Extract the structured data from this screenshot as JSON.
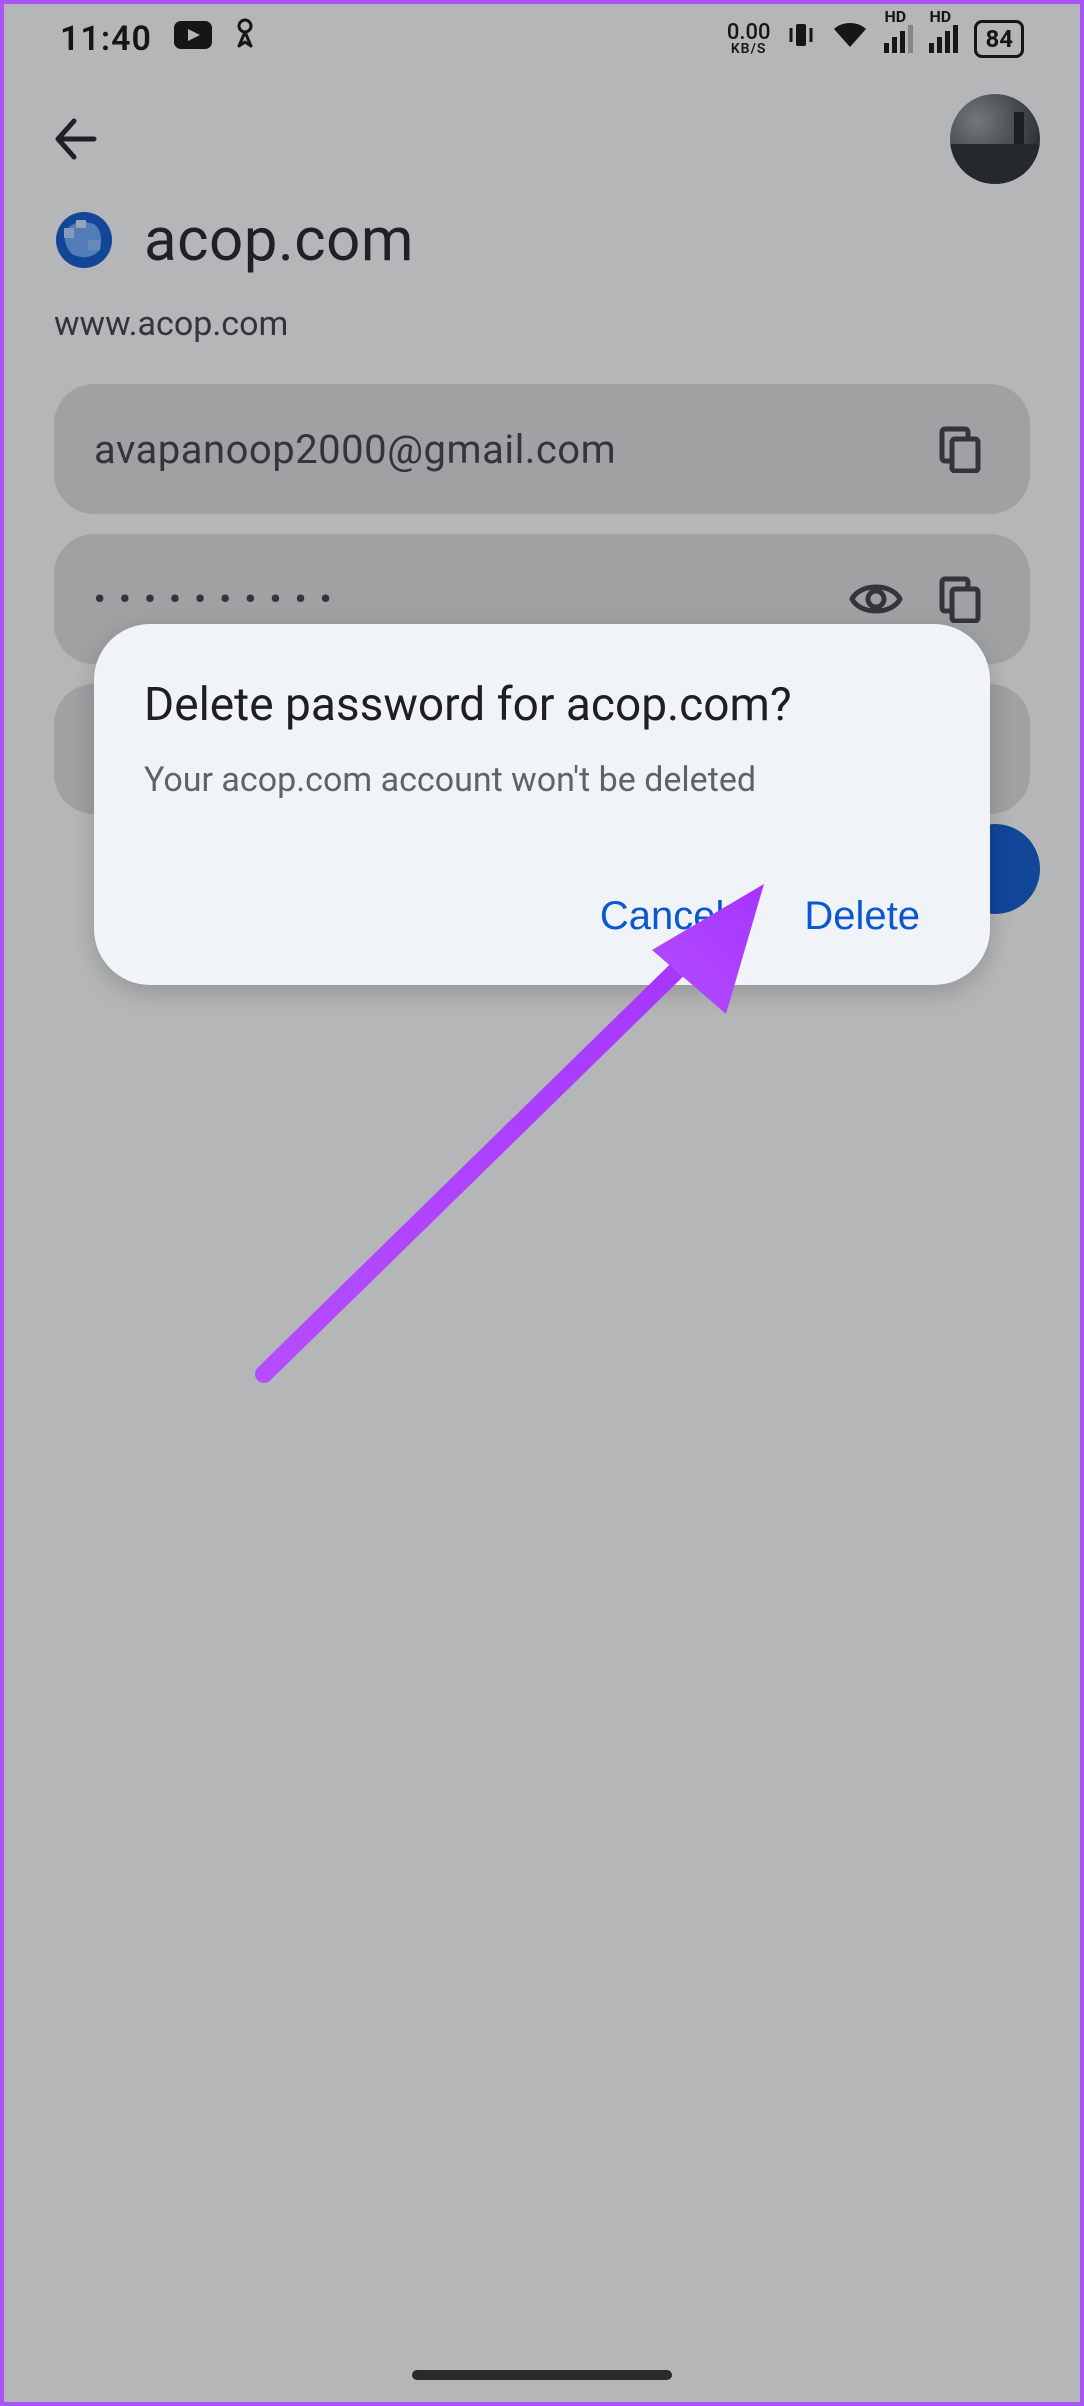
{
  "status_bar": {
    "time": "11:40",
    "data_rate_value": "0.00",
    "data_rate_unit": "KB/S",
    "hd1": "HD",
    "hd2": "HD",
    "battery": "84"
  },
  "page": {
    "site_title": "acop.com",
    "site_url": "www.acop.com"
  },
  "fields": {
    "username": "avapanoop2000@gmail.com",
    "password_mask": "••••••••••"
  },
  "dialog": {
    "title": "Delete password for acop.com?",
    "body": "Your acop.com account won't be deleted",
    "cancel": "Cancel",
    "confirm": "Delete"
  }
}
